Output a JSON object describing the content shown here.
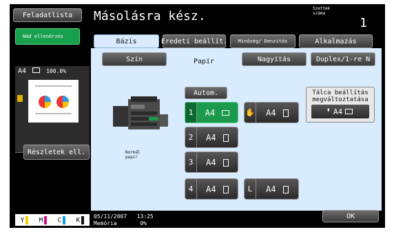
{
  "left": {
    "job_list": "Feladatlista",
    "proof": "Nád ellenőrzés",
    "status_paper": "A4",
    "status_zoom": "100.0%",
    "details": "Részletek ell.",
    "toner": [
      "Y",
      "M",
      "C",
      "K"
    ]
  },
  "header": {
    "title": "Másolásra kész.",
    "copies_label": "Szettek száma",
    "copies": "1"
  },
  "tabs_top": [
    "Bázis",
    "Eredeti beállít.",
    "Minőség/ Denzitás",
    "Alkalmazás"
  ],
  "tabs_sub": [
    "Szín",
    "Papír",
    "Nagyítás",
    "Duplex/1-re N"
  ],
  "paper": {
    "auto": "Autom.",
    "trays": [
      {
        "num": "1",
        "size": "A4"
      },
      {
        "num": "2",
        "size": "A4"
      },
      {
        "num": "3",
        "size": "A4"
      },
      {
        "num": "4",
        "size": "A4"
      }
    ],
    "bypass": {
      "size": "A4"
    },
    "lct": {
      "num": "L",
      "size": "A4"
    },
    "paper_type": "Normál papír",
    "tray_setting_label": "Tálca beállítás megváltoztatása",
    "tray_setting_value": "A4"
  },
  "footer": {
    "date": "05/11/2007",
    "time": "13:25",
    "memory_label": "Memória",
    "memory_value": "0%",
    "ok": "OK"
  }
}
